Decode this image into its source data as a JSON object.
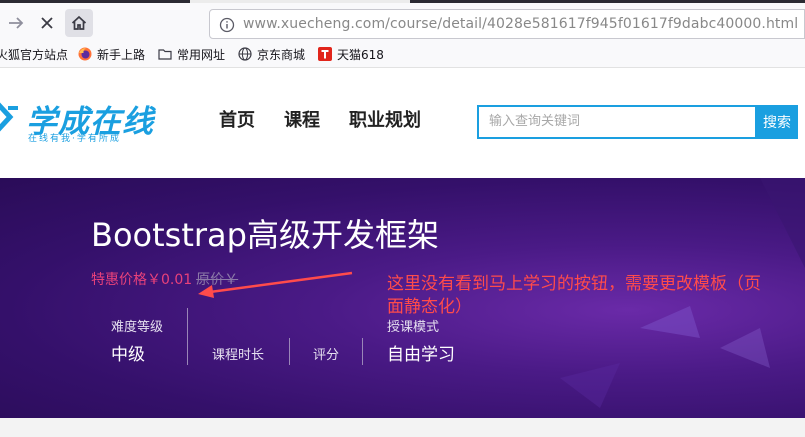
{
  "browser": {
    "url": "www.xuecheng.com/course/detail/4028e581617f945f01617f9dabc40000.html",
    "bookmarks": [
      {
        "label": "火狐官方站点",
        "icon": "firefox-icon"
      },
      {
        "label": "新手上路",
        "icon": "firefox-icon"
      },
      {
        "label": "常用网址",
        "icon": "folder-icon"
      },
      {
        "label": "京东商城",
        "icon": "globe-icon"
      },
      {
        "label": "天猫618",
        "icon": "tmall-icon"
      }
    ]
  },
  "site": {
    "logo_text": "学成在线",
    "logo_slogan": "在线有我·学有所成",
    "nav": [
      "首页",
      "课程",
      "职业规划"
    ],
    "search_placeholder": "输入查询关键词",
    "search_button": "搜索"
  },
  "course": {
    "title": "Bootstrap高级开发框架",
    "price_label": "特惠价格￥0.01",
    "original_price": "原价￥",
    "difficulty_label": "难度等级",
    "difficulty_value": "中级",
    "duration_label": "课程时长",
    "rating_label": "评分",
    "mode_label": "授课模式",
    "mode_value": "自由学习"
  },
  "annotation": {
    "text": "这里没有看到马上学习的按钮，需要更改模板（页面静态化）",
    "color": "#ff4b4b"
  },
  "colors": {
    "brand_blue": "#1a9fe0",
    "banner_purple": "#4a1a86",
    "price_pink": "#e8417a"
  }
}
